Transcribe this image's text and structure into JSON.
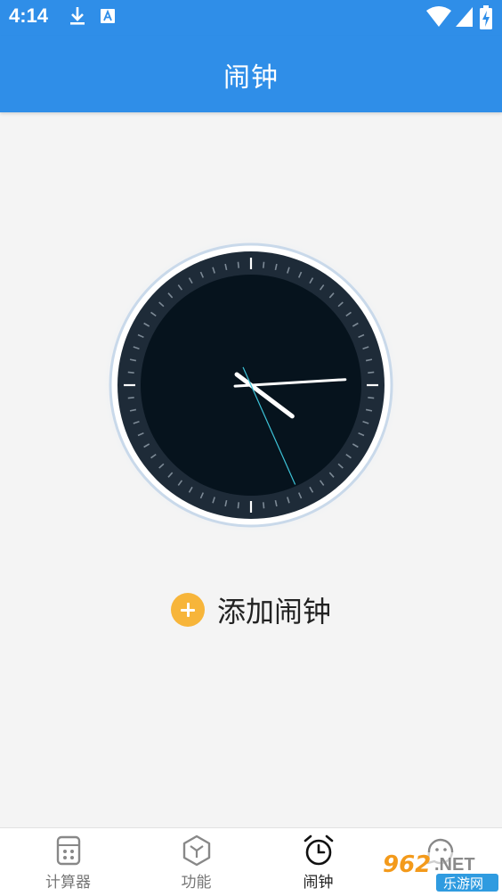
{
  "status_bar": {
    "time": "4:14",
    "icons": [
      "download-icon",
      "keyboard-a-icon",
      "wifi-icon",
      "signal-icon",
      "battery-charging-icon"
    ]
  },
  "app_bar": {
    "title": "闹钟"
  },
  "clock": {
    "face_color": "#06131d",
    "bezel_color": "#1e2b38",
    "second_hand_color": "#3dc3d8",
    "time_shown": "4:14:26"
  },
  "add_alarm": {
    "label": "添加闹钟",
    "icon": "plus-circle-icon",
    "accent": "#f7b53a"
  },
  "bottom_nav": {
    "items": [
      {
        "label": "计算器",
        "icon": "calculator-icon",
        "active": false
      },
      {
        "label": "功能",
        "icon": "cube-icon",
        "active": false
      },
      {
        "label": "闹钟",
        "icon": "alarm-clock-icon",
        "active": true
      },
      {
        "label": "",
        "icon": "face-icon",
        "active": false
      }
    ]
  },
  "watermark": {
    "top": "962.NET",
    "bottom": "乐游网"
  },
  "colors": {
    "primary": "#2f8ee8",
    "background": "#f4f4f4"
  }
}
